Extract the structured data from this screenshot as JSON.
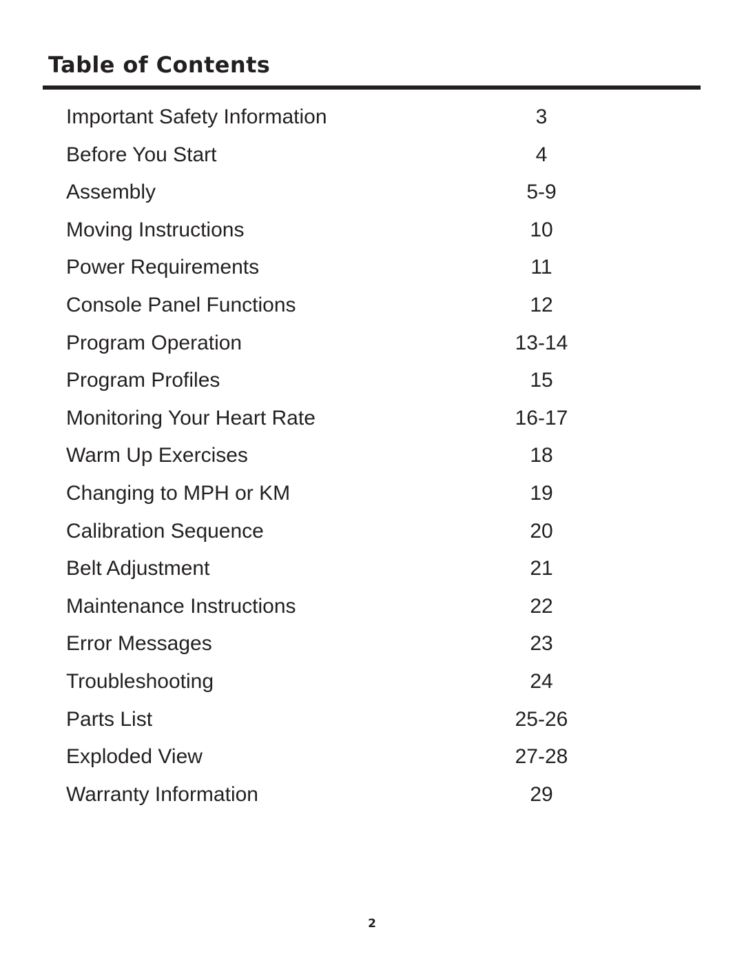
{
  "document": {
    "heading": "Table of Contents",
    "footer_page_number": "2",
    "text_color": "#231f20",
    "background_color": "#ffffff"
  },
  "toc": {
    "entries": [
      {
        "label": "Important Safety Information",
        "page": "3"
      },
      {
        "label": "Before You Start",
        "page": "4"
      },
      {
        "label": "Assembly",
        "page": "5-9"
      },
      {
        "label": "Moving Instructions",
        "page": "10"
      },
      {
        "label": "Power Requirements",
        "page": "11"
      },
      {
        "label": "Console Panel Functions",
        "page": "12"
      },
      {
        "label": "Program Operation",
        "page": "13-14"
      },
      {
        "label": "Program Profiles",
        "page": "15"
      },
      {
        "label": "Monitoring Your Heart Rate",
        "page": "16-17"
      },
      {
        "label": "Warm Up Exercises",
        "page": "18"
      },
      {
        "label": "Changing to MPH or KM",
        "page": "19"
      },
      {
        "label": "Calibration Sequence",
        "page": "20"
      },
      {
        "label": "Belt Adjustment",
        "page": "21"
      },
      {
        "label": "Maintenance Instructions",
        "page": "22"
      },
      {
        "label": "Error Messages",
        "page": "23"
      },
      {
        "label": "Troubleshooting",
        "page": "24"
      },
      {
        "label": "Parts List",
        "page": "25-26"
      },
      {
        "label": "Exploded View",
        "page": "27-28"
      },
      {
        "label": "Warranty Information",
        "page": "29"
      }
    ]
  }
}
